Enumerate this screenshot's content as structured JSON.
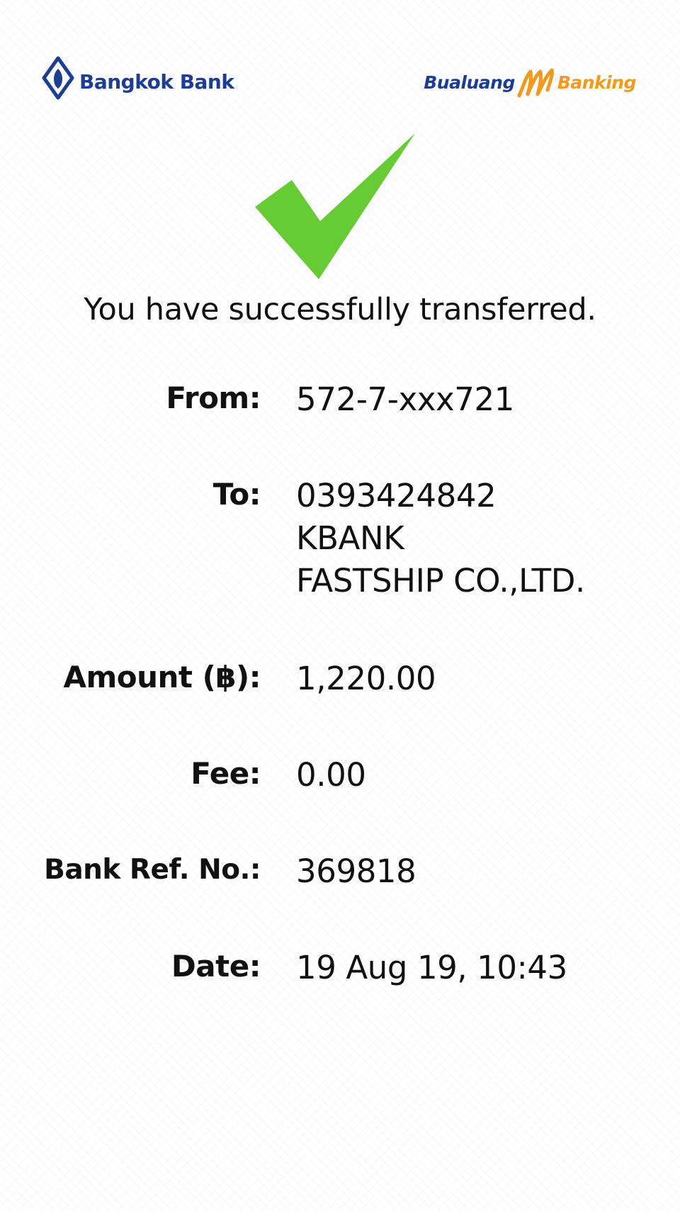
{
  "header": {
    "left_brand": "Bangkok Bank",
    "right_brand_part1": "Bualuang",
    "right_brand_part2": "Banking",
    "brand_blue": "#1b3d96",
    "brand_orange": "#f39a1d",
    "status_icon": "check-icon",
    "status_color": "#66cc33"
  },
  "message": "You have successfully transferred.",
  "details": {
    "from_label": "From:",
    "from_value": "572-7-xxx721",
    "to_label": "To:",
    "to_lines": [
      "0393424842",
      "KBANK",
      "FASTSHIP CO.,LTD."
    ],
    "amount_label": "Amount (฿):",
    "amount_value": "1,220.00",
    "fee_label": "Fee:",
    "fee_value": "0.00",
    "ref_label": "Bank Ref. No.:",
    "ref_value": "369818",
    "date_label": "Date:",
    "date_value": "19 Aug 19, 10:43"
  }
}
